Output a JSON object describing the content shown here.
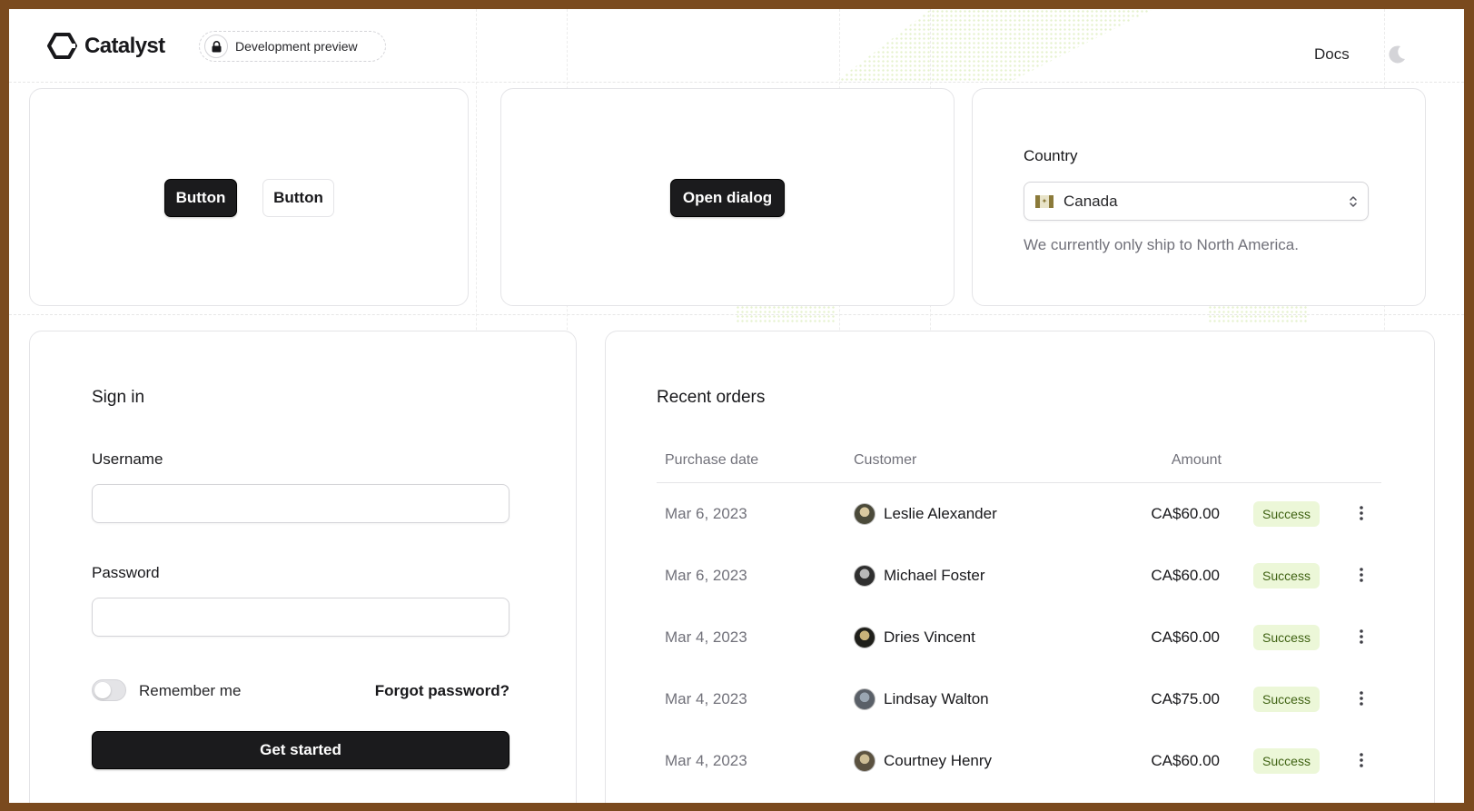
{
  "header": {
    "brand": "Catalyst",
    "badge_label": "Development preview",
    "docs_label": "Docs"
  },
  "buttons_card": {
    "primary_label": "Button",
    "secondary_label": "Button"
  },
  "dialog_card": {
    "open_dialog_label": "Open dialog"
  },
  "country_card": {
    "label": "Country",
    "selected": "Canada",
    "help_text": "We currently only ship to North America."
  },
  "sign_in": {
    "title": "Sign in",
    "username_label": "Username",
    "username_value": "",
    "password_label": "Password",
    "password_value": "",
    "remember_label": "Remember me",
    "forgot_label": "Forgot password?",
    "submit_label": "Get started"
  },
  "orders": {
    "title": "Recent orders",
    "columns": [
      "Purchase date",
      "Customer",
      "Amount"
    ],
    "rows": [
      {
        "date": "Mar 6, 2023",
        "customer": "Leslie Alexander",
        "amount": "CA$60.00",
        "status": "Success"
      },
      {
        "date": "Mar 6, 2023",
        "customer": "Michael Foster",
        "amount": "CA$60.00",
        "status": "Success"
      },
      {
        "date": "Mar 4, 2023",
        "customer": "Dries Vincent",
        "amount": "CA$60.00",
        "status": "Success"
      },
      {
        "date": "Mar 4, 2023",
        "customer": "Lindsay Walton",
        "amount": "CA$75.00",
        "status": "Success"
      },
      {
        "date": "Mar 4, 2023",
        "customer": "Courtney Henry",
        "amount": "CA$60.00",
        "status": "Success"
      }
    ]
  },
  "colors": {
    "frame": "#7a4a1e",
    "primary": "#1b1b1d",
    "success_bg": "#ecf7d8",
    "success_text": "#3f6212"
  },
  "icons": [
    "catalyst-logo-icon",
    "lock-icon",
    "moon-icon",
    "canada-flag-icon",
    "chevron-up-down-icon",
    "avatar-icon",
    "more-vertical-icon"
  ]
}
